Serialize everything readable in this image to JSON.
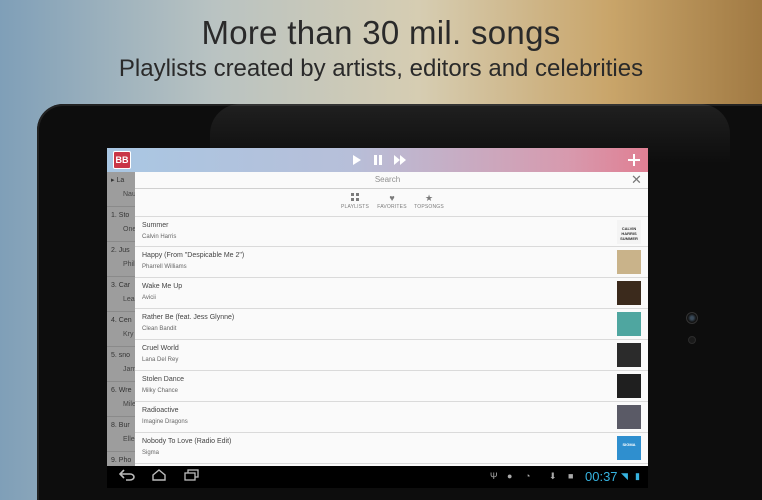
{
  "promo": {
    "headline": "More than 30 mil. songs",
    "subline": "Playlists created by artists, editors and celebrities"
  },
  "topbar": {
    "logo_text": "BB",
    "play_icon": "play-icon",
    "pause_icon": "pause-icon",
    "next_icon": "fast-forward-icon",
    "add_icon": "plus-icon"
  },
  "background_list": [
    {
      "line1": "▸  La",
      "line2": "Nau"
    },
    {
      "line1": "1.  Sto",
      "line2": "One"
    },
    {
      "line1": "2.  Jus",
      "line2": "Phil"
    },
    {
      "line1": "3.  Car",
      "line2": "Lea"
    },
    {
      "line1": "4.  Cen",
      "line2": "Kry"
    },
    {
      "line1": "5.  sno",
      "line2": "Jam"
    },
    {
      "line1": "6.  Wre",
      "line2": "Mile"
    },
    {
      "line1": "8.  Bur",
      "line2": "Elle"
    },
    {
      "line1": "9.  Pho",
      "line2": ""
    }
  ],
  "search": {
    "placeholder": "Search",
    "close_icon": "close-icon"
  },
  "tabs": [
    {
      "label": "PLAYLISTS",
      "icon": "grid-icon"
    },
    {
      "label": "FAVORITES",
      "icon": "heart-icon"
    },
    {
      "label": "TOPSONGS",
      "icon": "star-icon"
    }
  ],
  "songs": [
    {
      "title": "Summer",
      "artist": "Calvin Harris",
      "cover_text": "CALVIN HARRIS SUMMER",
      "cover_color": "#f4f4f4"
    },
    {
      "title": "Happy (From \"Despicable Me 2\")",
      "artist": "Pharrell Williams",
      "cover_text": "",
      "cover_color": "#c9b38a"
    },
    {
      "title": "Wake Me Up",
      "artist": "Avicii",
      "cover_text": "",
      "cover_color": "#3b2a1c"
    },
    {
      "title": "Rather Be (feat. Jess Glynne)",
      "artist": "Clean Bandit",
      "cover_text": "",
      "cover_color": "#4fa6a0"
    },
    {
      "title": "Cruel World",
      "artist": "Lana Del Rey",
      "cover_text": "",
      "cover_color": "#2b2b2b"
    },
    {
      "title": "Stolen Dance",
      "artist": "Milky Chance",
      "cover_text": "",
      "cover_color": "#1f1f1f"
    },
    {
      "title": "Radioactive",
      "artist": "Imagine Dragons",
      "cover_text": "",
      "cover_color": "#5a5a66"
    },
    {
      "title": "Nobody To Love (Radio Edit)",
      "artist": "Sigma",
      "cover_text": "SIGMA",
      "cover_color": "#2f8fcf"
    }
  ],
  "system_bar": {
    "back_icon": "back-icon",
    "home_icon": "home-icon",
    "recents_icon": "recents-icon",
    "status_icons": [
      "usb-icon",
      "alert-icon",
      "sync-icon",
      "download-icon",
      "briefcase-icon"
    ],
    "time": "00:37",
    "wifi_icon": "wifi-icon",
    "battery_icon": "battery-icon"
  },
  "colors": {
    "accent_clock": "#36b3e0",
    "logo_red": "#c93546"
  }
}
